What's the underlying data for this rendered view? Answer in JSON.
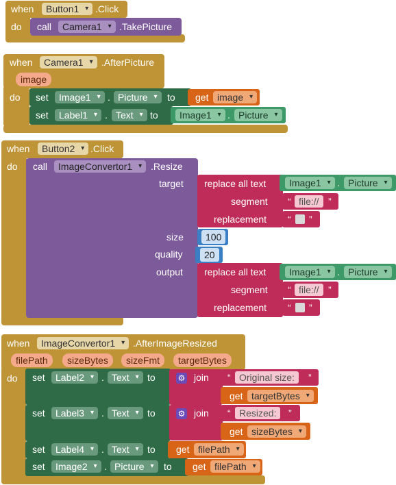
{
  "labels": {
    "when": "when",
    "do": "do",
    "call": "call",
    "set": "set",
    "to": "to",
    "get": "get",
    "dot": ".",
    "target": "target",
    "size": "size",
    "quality": "quality",
    "output": "output",
    "replace": "replace all text",
    "segment": "segment",
    "replacement": "replacement",
    "join": "join",
    "open_q": "“",
    "close_q": "”"
  },
  "block1": {
    "component": "Button1",
    "event": ".Click",
    "call_component": "Camera1",
    "method": ".TakePicture"
  },
  "block2": {
    "component": "Camera1",
    "event": ".AfterPicture",
    "param": "image",
    "row1": {
      "component": "Image1",
      "property": "Picture",
      "value_var": "image"
    },
    "row2": {
      "component": "Label1",
      "property": "Text",
      "value_component": "Image1",
      "value_property": "Picture"
    }
  },
  "block3": {
    "component": "Button2",
    "event": ".Click",
    "call_component": "ImageConvertor1",
    "method": ".Resize",
    "target": {
      "component": "Image1",
      "property": "Picture",
      "segment": "file://"
    },
    "size": "100",
    "quality": "20",
    "output": {
      "component": "Image1",
      "property": "Picture",
      "segment": "file://"
    }
  },
  "block4": {
    "component": "ImageConvertor1",
    "event": ".AfterImageResized",
    "params": [
      "filePath",
      "sizeBytes",
      "sizeFmt",
      "targetBytes"
    ],
    "rows": [
      {
        "component": "Label2",
        "property": "Text",
        "text": "Original size: ",
        "var": "targetBytes"
      },
      {
        "component": "Label3",
        "property": "Text",
        "text": "Resized: ",
        "var": "sizeBytes"
      },
      {
        "component": "Label4",
        "property": "Text",
        "var": "filePath"
      },
      {
        "component": "Image2",
        "property": "Picture",
        "var": "filePath"
      }
    ]
  },
  "colors": {
    "event": "#bf9436",
    "procedure": "#7d5a9a",
    "setter": "#2e6b46",
    "getter": "#3d9a68",
    "text": "#c02c5a",
    "variable": "#d86418",
    "math": "#3a7fc4"
  }
}
